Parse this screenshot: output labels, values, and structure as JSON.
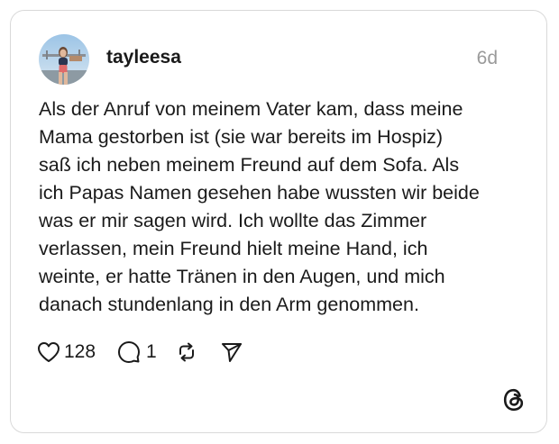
{
  "post": {
    "username": "tayleesa",
    "time": "6d",
    "lines": [
      "Als der Anruf von meinem Vater kam, dass meine",
      "Mama gestorben ist (sie war bereits im Hospiz)",
      "saß ich neben meinem Freund auf dem Sofa. Als",
      "ich Papas Namen gesehen habe wussten wir beide",
      "was er mir sagen wird. Ich wollte das Zimmer",
      "verlassen, mein Freund hielt meine Hand, ich",
      "weinte, er hatte Tränen in den Augen, und mich",
      "danach stundenlang in den Arm genommen."
    ]
  },
  "actions": {
    "like_icon": "heart-icon",
    "like_count": "128",
    "reply_icon": "comment-icon",
    "reply_count": "1",
    "repost_icon": "repost-icon",
    "share_icon": "send-icon"
  },
  "brand": {
    "logo": "threads-logo"
  },
  "colors": {
    "text": "#1a1a1a",
    "muted": "#9a9a9a",
    "border": "#d9d9d9"
  }
}
